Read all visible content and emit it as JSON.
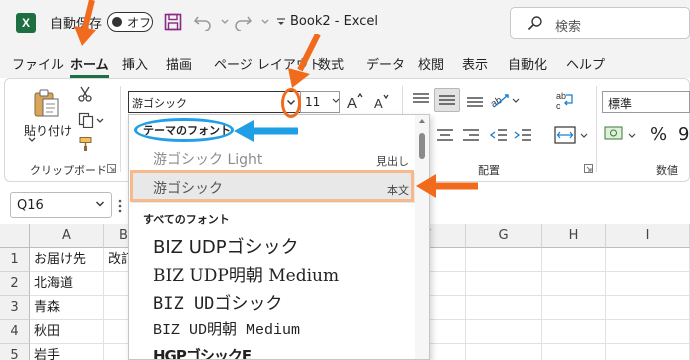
{
  "app": {
    "icon_letter": "X",
    "autosave_label": "自動保存",
    "autosave_state": "オフ",
    "document_title": "Book2 - Excel"
  },
  "search": {
    "placeholder": "検索"
  },
  "tabs": [
    "ファイル",
    "ホーム",
    "挿入",
    "描画",
    "ページ レイアウト",
    "数式",
    "データ",
    "校閲",
    "表示",
    "自動化",
    "ヘルプ"
  ],
  "active_tab": "ホーム",
  "ribbon": {
    "clipboard": {
      "paste_label": "貼り付け",
      "group_label": "クリップボード"
    },
    "font": {
      "current_font": "游ゴシック",
      "current_size": "11",
      "grow_label": "A^",
      "shrink_label": "Aˇ"
    },
    "alignment": {
      "group_label": "配置"
    },
    "number": {
      "format_value": "標準",
      "group_label": "数値",
      "percent": "%",
      "comma": "9"
    }
  },
  "namebox": {
    "value": "Q16"
  },
  "font_menu": {
    "theme_header": "テーマのフォント",
    "theme_fonts": [
      {
        "name": "游ゴシック Light",
        "tag": "見出し"
      },
      {
        "name": "游ゴシック",
        "tag": "本文"
      }
    ],
    "all_header": "すべてのフォント",
    "all_fonts": [
      "BIZ UDPゴシック",
      "BIZ UDP明朝 Medium",
      "BIZ UDゴシック",
      "BIZ UD明朝 Medium",
      "HGPゴシックE"
    ]
  },
  "grid": {
    "columns": [
      "A",
      "B",
      "C",
      "D",
      "E",
      "F",
      "G",
      "H",
      "I"
    ],
    "rows": [
      "1",
      "2",
      "3",
      "4",
      "5"
    ],
    "cells": {
      "A1": "お届け先",
      "B1": "改訂",
      "A2": "北海道",
      "A3": "青森",
      "A4": "秋田",
      "A5": "岩手"
    }
  },
  "colors": {
    "accent_green": "#1d6f42",
    "callout_orange": "#f26b1d",
    "callout_blue": "#1fa0e6",
    "highlight_box": "#f6b98c"
  }
}
